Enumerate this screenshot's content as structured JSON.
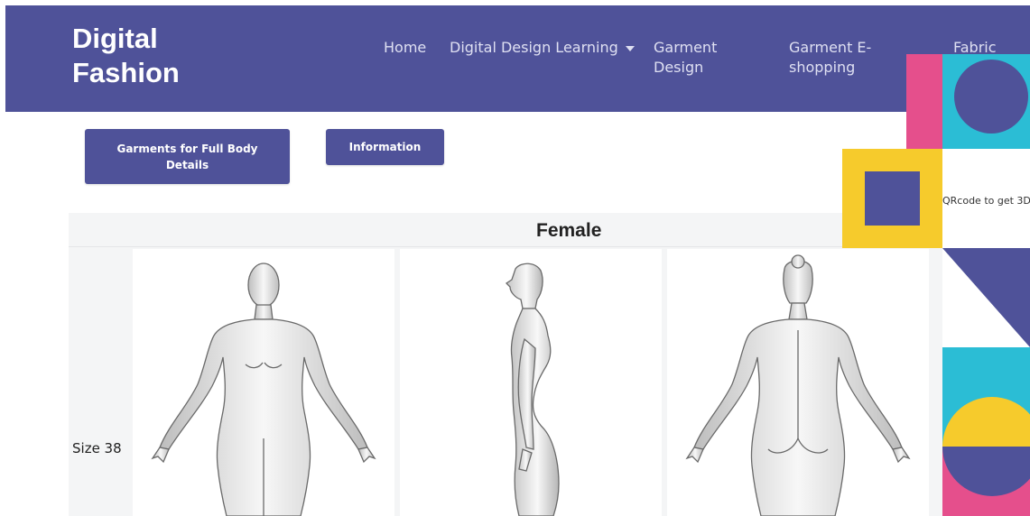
{
  "brand": {
    "line1": "Digital",
    "line2": "Fashion"
  },
  "nav": {
    "home": "Home",
    "digital_design_learning": "Digital Design Learning",
    "garment_design": "Garment Design",
    "garment_eshopping": "Garment E-shopping",
    "fabric": "Fabric"
  },
  "buttons": {
    "garments_full_body": "Garments for Full Body Details",
    "information": "Information"
  },
  "table": {
    "title": "Female",
    "row_label": "Size 38",
    "views": [
      "front-view",
      "side-view",
      "back-view"
    ]
  },
  "qr_panel": {
    "caption": "QRcode to get 3D"
  },
  "colors": {
    "primary": "#4f5299",
    "pink": "#e54f8c",
    "cyan": "#2bbdd5",
    "yellow": "#f6cb2c"
  }
}
